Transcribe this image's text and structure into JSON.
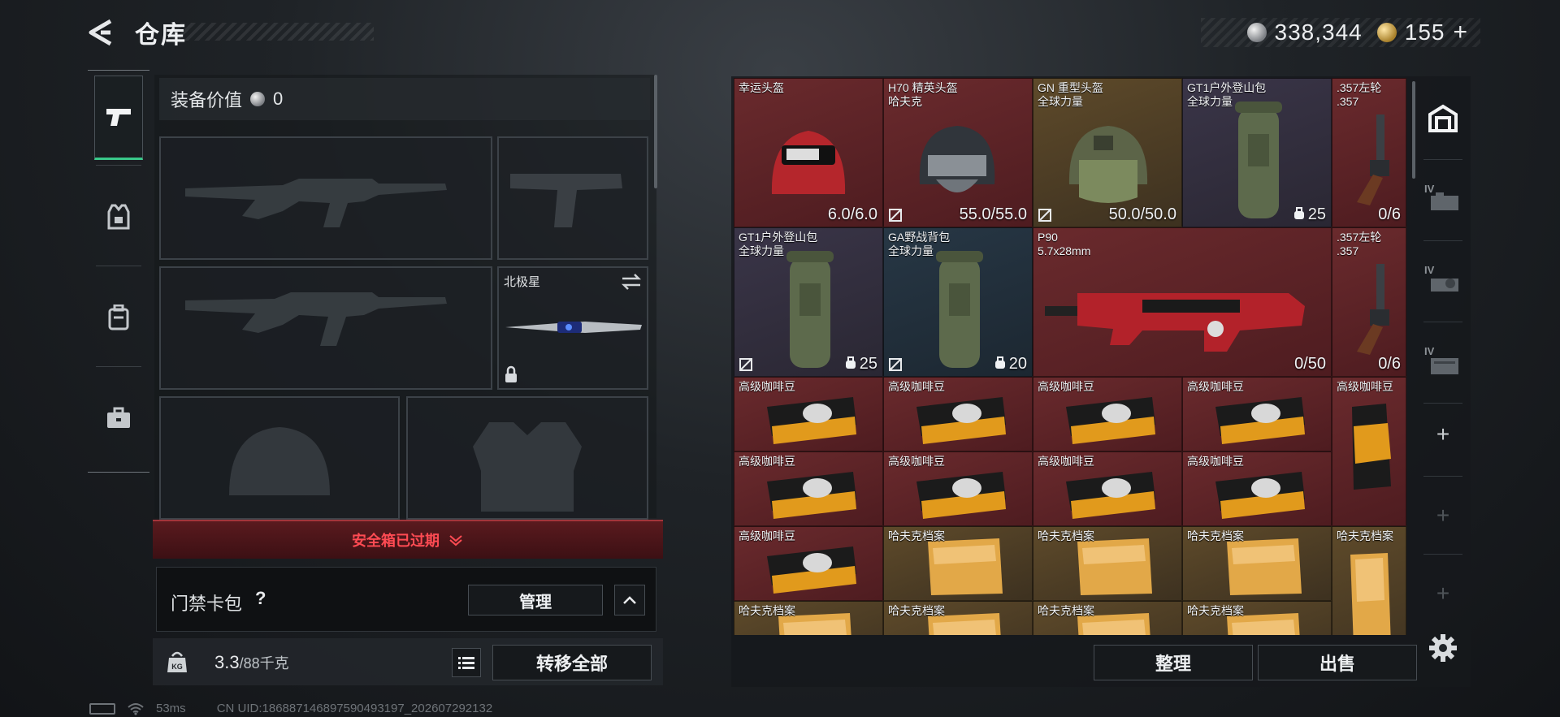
{
  "header": {
    "title": "仓库",
    "currencies": [
      {
        "icon": "silver-coin-icon",
        "value": "338,344"
      },
      {
        "icon": "gold-coin-icon",
        "value": "155"
      }
    ],
    "add_symbol": "+"
  },
  "equipment": {
    "value_label": "装备价值",
    "value": "0",
    "melee_slot_label": "北极星"
  },
  "safebox": {
    "label": "安全箱已过期"
  },
  "cardpack": {
    "label": "门禁卡包",
    "help": "?",
    "manage_label": "管理"
  },
  "weight": {
    "current": "3.3",
    "capacity": "/88千克",
    "icon_label": "KG"
  },
  "actions": {
    "transfer_all": "转移全部",
    "sort": "整理",
    "sell": "出售"
  },
  "status_bar": {
    "ping": "53ms",
    "uid": "CN UID:186887146897590493197_202607292132"
  },
  "inventory": [
    {
      "name": "幸运头盔",
      "sub": "",
      "value": "6.0/6.0",
      "bg": "red",
      "nomod": false
    },
    {
      "name": "H70 精英头盔",
      "sub": "哈夫克",
      "value": "55.0/55.0",
      "bg": "red",
      "nomod": true
    },
    {
      "name": "GN 重型头盔",
      "sub": "全球力量",
      "value": "50.0/50.0",
      "bg": "gold",
      "nomod": true
    },
    {
      "name": "GT1户外登山包",
      "sub": "全球力量",
      "value": "25",
      "bg": "purple",
      "nomod": false
    },
    {
      "name": ".357左轮",
      "sub": ".357",
      "value": "0/6",
      "bg": "red",
      "nomod": false
    },
    {
      "name": "GT1户外登山包",
      "sub": "全球力量",
      "value": "25",
      "bg": "purple",
      "nomod": true
    },
    {
      "name": "GA野战背包",
      "sub": "全球力量",
      "value": "20",
      "bg": "blue",
      "nomod": true
    },
    {
      "name": "P90",
      "sub": "5.7x28mm",
      "value": "0/50",
      "bg": "red",
      "nomod": false
    },
    {
      "name": ".357左轮",
      "sub": ".357",
      "value": "0/6",
      "bg": "red",
      "nomod": false
    },
    {
      "name": "高级咖啡豆",
      "sub": "",
      "value": "",
      "bg": "red"
    },
    {
      "name": "高级咖啡豆",
      "sub": "",
      "value": "",
      "bg": "red"
    },
    {
      "name": "高级咖啡豆",
      "sub": "",
      "value": "",
      "bg": "red"
    },
    {
      "name": "高级咖啡豆",
      "sub": "",
      "value": "",
      "bg": "red"
    },
    {
      "name": "高级咖啡豆",
      "sub": "",
      "value": "",
      "bg": "red"
    },
    {
      "name": "高级咖啡豆",
      "sub": "",
      "value": "",
      "bg": "red"
    },
    {
      "name": "高级咖啡豆",
      "sub": "",
      "value": "",
      "bg": "red"
    },
    {
      "name": "高级咖啡豆",
      "sub": "",
      "value": "",
      "bg": "red"
    },
    {
      "name": "高级咖啡豆",
      "sub": "",
      "value": "",
      "bg": "red"
    },
    {
      "name": "高级咖啡豆",
      "sub": "",
      "value": "",
      "bg": "red"
    },
    {
      "name": "哈夫克档案",
      "sub": "",
      "value": "",
      "bg": "gold"
    },
    {
      "name": "哈夫克档案",
      "sub": "",
      "value": "",
      "bg": "gold"
    },
    {
      "name": "哈夫克档案",
      "sub": "",
      "value": "",
      "bg": "gold"
    },
    {
      "name": "哈夫克档案",
      "sub": "",
      "value": "",
      "bg": "gold"
    },
    {
      "name": "哈夫克档案",
      "sub": "",
      "value": "",
      "bg": "gold"
    },
    {
      "name": "哈夫克档案",
      "sub": "",
      "value": "",
      "bg": "gold"
    },
    {
      "name": "哈夫克档案",
      "sub": "",
      "value": "",
      "bg": "gold"
    },
    {
      "name": "哈夫克档案",
      "sub": "",
      "value": "",
      "bg": "gold"
    }
  ],
  "right_rail": {
    "tabs": [
      "IV",
      "IV",
      "IV"
    ],
    "add_symbol": "+"
  }
}
